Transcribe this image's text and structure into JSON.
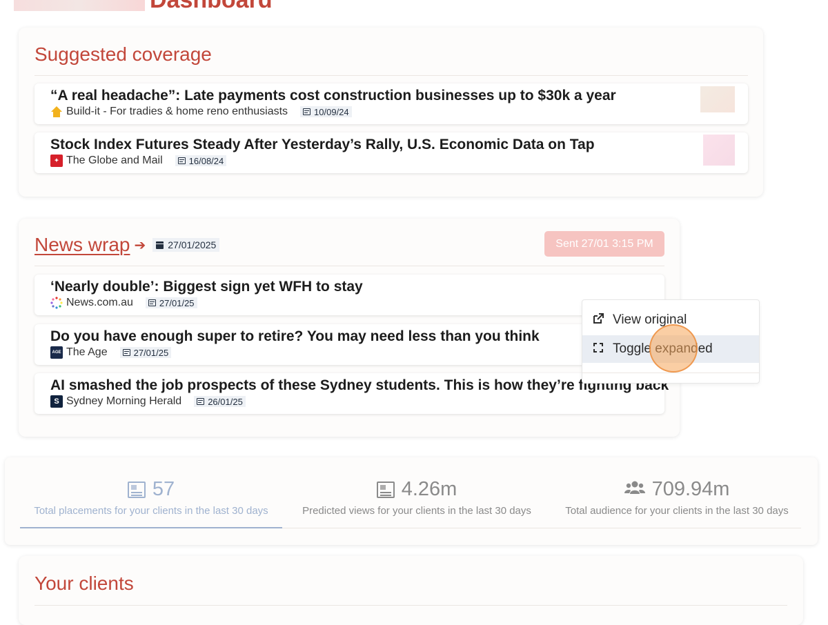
{
  "header": {
    "title": "Dashboard"
  },
  "suggested": {
    "title": "Suggested coverage",
    "articles": [
      {
        "headline": "“A real headache”: Late payments cost construction businesses up to $30k a year",
        "source": "Build-it - For tradies & home reno enthusiasts",
        "date": "10/09/24",
        "source_icon": "house-icon"
      },
      {
        "headline": "Stock Index Futures Steady After Yesterday’s Rally, U.S. Economic Data on Tap",
        "source": "The Globe and Mail",
        "date": "16/08/24",
        "source_icon": "maple-leaf-icon"
      }
    ]
  },
  "news_wrap": {
    "title": "News wrap",
    "arrow": "➔",
    "date": "27/01/2025",
    "sent_label": "Sent 27/01 3:15 PM",
    "articles": [
      {
        "headline": "‘Nearly double’: Biggest sign yet WFH to stay",
        "source": "News.com.au",
        "date": "27/01/25",
        "source_icon": "news-com-au-icon"
      },
      {
        "headline": "Do you have enough super to retire? You may need less than you think",
        "source": "The Age",
        "date": "27/01/25",
        "source_icon": "the-age-icon",
        "icon_text": "AGE"
      },
      {
        "headline": "AI smashed the job prospects of these Sydney students. This is how they’re fighting back",
        "source": "Sydney Morning Herald",
        "date": "26/01/25",
        "source_icon": "smh-icon",
        "icon_text": "S"
      }
    ]
  },
  "context_menu": {
    "items": [
      {
        "label": "View original",
        "icon": "external-link-icon"
      },
      {
        "label": "Toggle expanded",
        "icon": "expand-icon"
      }
    ]
  },
  "stats": [
    {
      "value": "57",
      "label": "Total placements for your clients in the last 30 days",
      "icon": "newspaper-icon",
      "active": true
    },
    {
      "value": "4.26m",
      "label": "Predicted views for your clients in the last 30 days",
      "icon": "newspaper-icon",
      "active": false
    },
    {
      "value": "709.94m",
      "label": "Total audience for your clients in the last 30 days",
      "icon": "users-icon",
      "active": false
    }
  ],
  "clients": {
    "title": "Your clients"
  },
  "colors": {
    "accent": "#c2473a",
    "sent_badge": "#f6c4c1",
    "active_stat": "#9fb2cf"
  }
}
